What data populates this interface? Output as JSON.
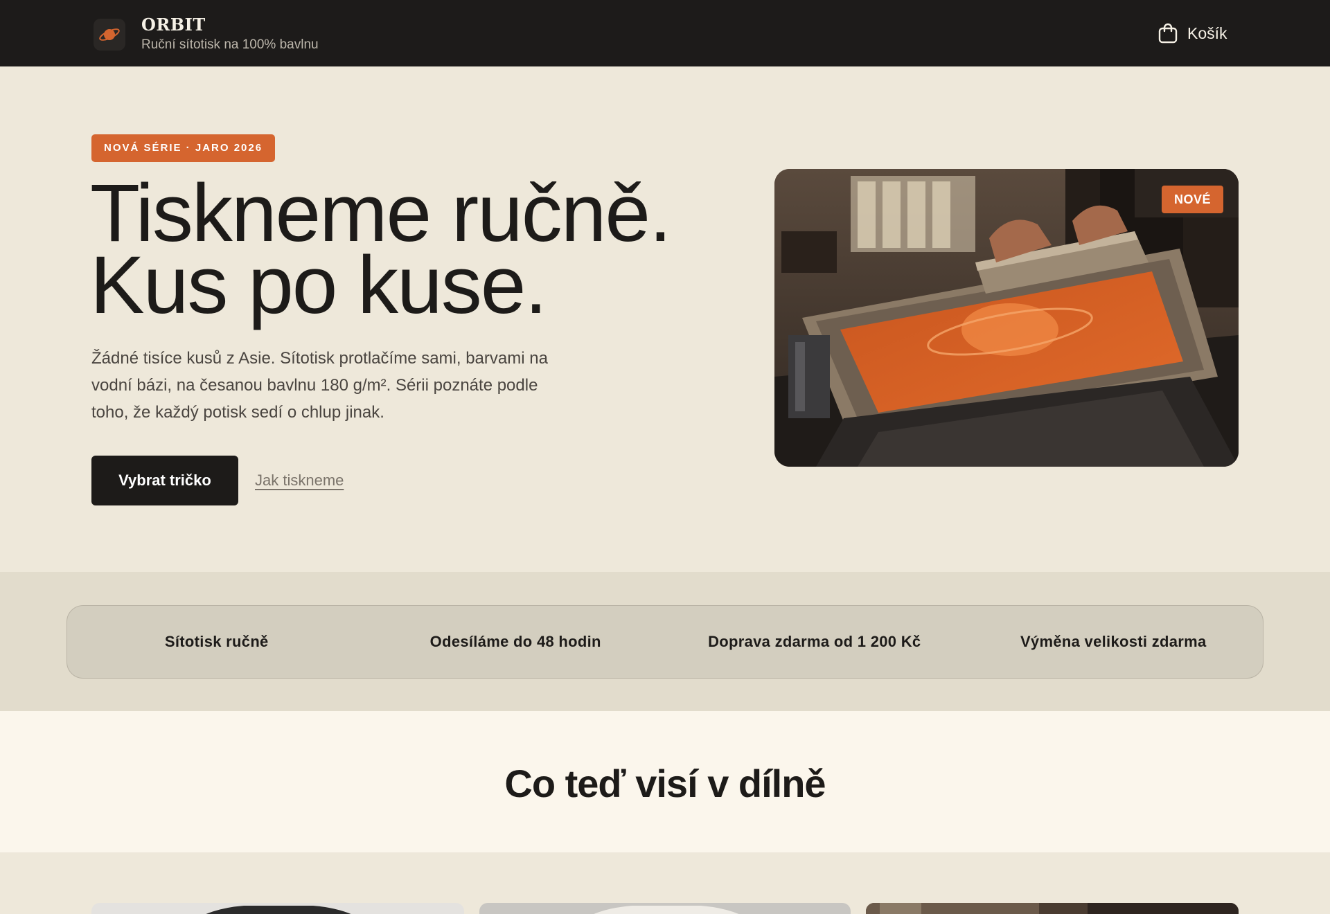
{
  "header": {
    "brand_name": "ORBIT",
    "brand_tagline": "Ruční sítotisk na 100% bavlnu",
    "cart_label": "Košík"
  },
  "hero": {
    "badge": "NOVÁ SÉRIE · JARO 2026",
    "headline_line1": "Tiskneme ručně.",
    "headline_line2": "Kus po kuse.",
    "lead": "Žádné tisíce kusů z Asie. Sítotisk protlačíme sami, barvami na vodní bázi, na česanou bavlnu 180 g/m². Sérii poznáte podle toho, že každý potisk sedí o chlup jinak.",
    "cta_primary": "Vybrat tričko",
    "cta_secondary": "Jak tiskneme",
    "image_tag": "NOVÉ"
  },
  "features": [
    {
      "label": "Sítotisk ručně"
    },
    {
      "label": "Odesíláme do 48 hodin"
    },
    {
      "label": "Doprava zdarma od 1 200 Kč"
    },
    {
      "label": "Výměna velikosti zdarma"
    }
  ],
  "section": {
    "title": "Co teď visí v dílně"
  },
  "colors": {
    "accent": "#D5652F",
    "dark": "#1d1b19",
    "background": "#EEE8DA",
    "band": "#E2DCCC",
    "section": "#FBF6EC"
  }
}
